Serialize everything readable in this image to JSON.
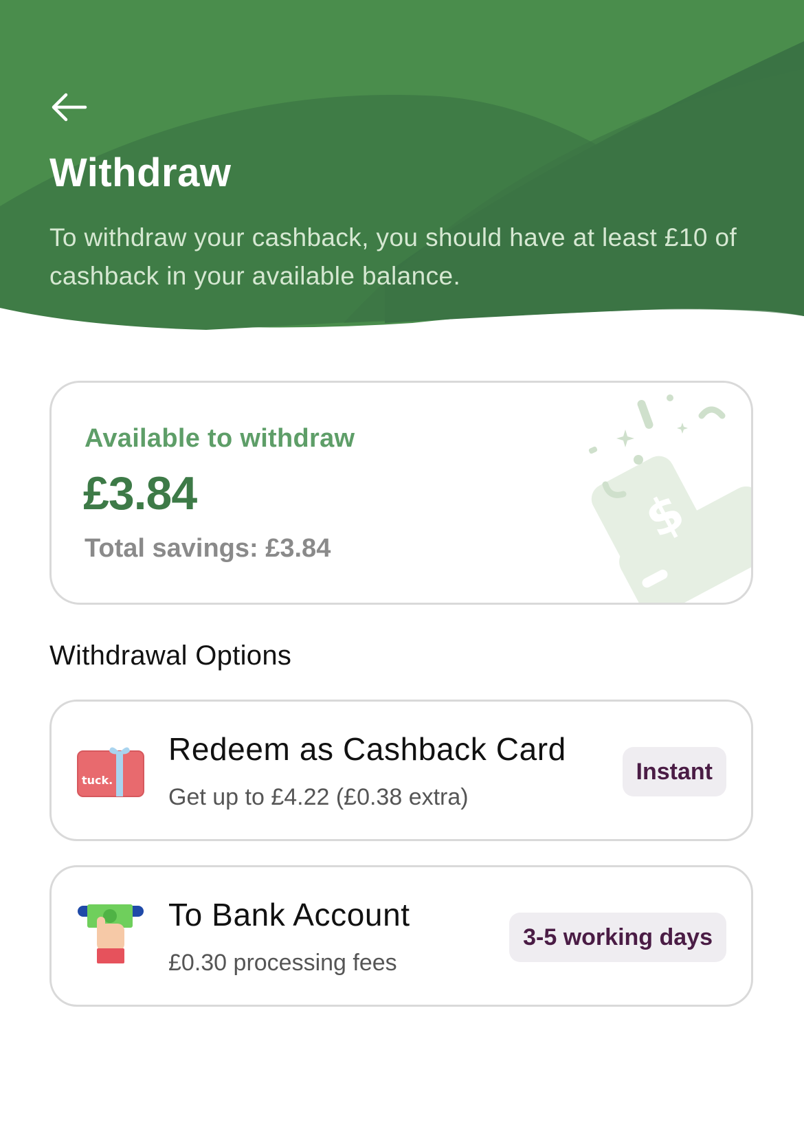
{
  "header": {
    "title": "Withdraw",
    "description": "To withdraw your cashback, you should have at least £10 of cashback in your available balance."
  },
  "balance": {
    "label": "Available to withdraw",
    "amount": "£3.84",
    "total": "Total savings: £3.84"
  },
  "section_title": "Withdrawal Options",
  "options": [
    {
      "title": "Redeem as Cashback Card",
      "subtitle": "Get up to £4.22 (£0.38 extra)",
      "badge": "Instant",
      "icon": "gift-card-icon",
      "card_brand": "tuck."
    },
    {
      "title": "To Bank Account",
      "subtitle": "£0.30 processing fees",
      "badge": "3-5 working days",
      "icon": "atm-cash-icon"
    }
  ],
  "icons": {
    "back": "arrow-left-icon",
    "decoration": "wallet-illustration"
  },
  "colors": {
    "header_green": "#4a8d4c",
    "header_dark_green": "#3a7344",
    "accent_green": "#3d7a47",
    "badge_bg": "#efedf1",
    "badge_text": "#4a1c45"
  }
}
